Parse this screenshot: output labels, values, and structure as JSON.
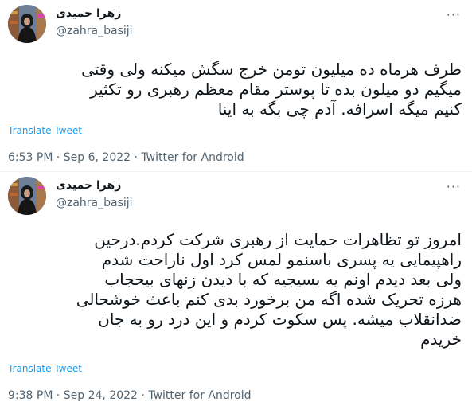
{
  "tweets": [
    {
      "author_name": "زهرا حمیدی",
      "handle": "@zahra_basiji",
      "more_label": "···",
      "text": "طرف هرماه ده میلیون تومن خرج سگش میکنه ولی وقتی\nمیگیم دو میلون بده تا پوستر مقام معظم رهبری رو تکثیر\nکنیم میگه اسرافه. آدم چی بگه به اینا",
      "translate_label": "Translate Tweet",
      "time": "6:53 PM",
      "date": "Sep 6, 2022",
      "source": "Twitter for Android",
      "separator": "·"
    },
    {
      "author_name": "زهرا حمیدی",
      "handle": "@zahra_basiji",
      "more_label": "···",
      "text": "امروز تو تظاهرات حمایت از رهبری شرکت کردم.درحین\nراهپیمایی یه پسری باسنمو لمس کرد اول ناراحت شدم\nولی بعد دیدم اونم یه بسیجیه که با دیدن زنهای بیحجاب\nهرزه تحریک شده اگه من برخورد بدی کنم باعث خوشحالی\nضدانقلاب میشه. پس سکوت کردم و این درد رو به جان\nخریدم",
      "translate_label": "Translate Tweet",
      "time": "9:38 PM",
      "date": "Sep 24, 2022",
      "source": "Twitter for Android",
      "separator": "·"
    }
  ]
}
